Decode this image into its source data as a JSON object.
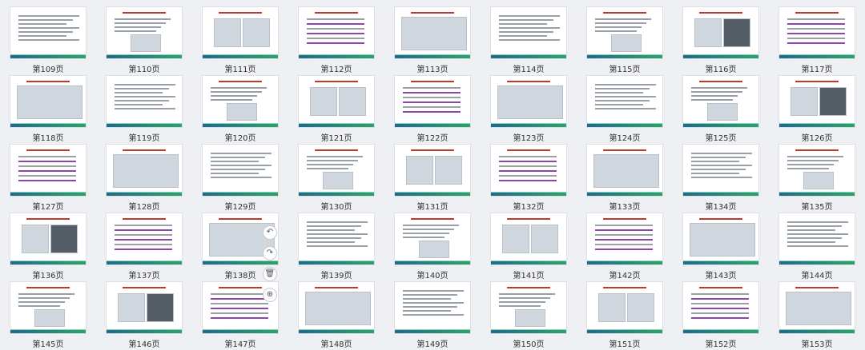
{
  "pages": [
    "第109页",
    "第110页",
    "第111页",
    "第112页",
    "第113页",
    "第114页",
    "第115页",
    "第116页",
    "第117页",
    "第118页",
    "第119页",
    "第120页",
    "第121页",
    "第122页",
    "第123页",
    "第124页",
    "第125页",
    "第126页",
    "第127页",
    "第128页",
    "第129页",
    "第130页",
    "第131页",
    "第132页",
    "第133页",
    "第134页",
    "第135页",
    "第136页",
    "第137页",
    "第138页",
    "第139页",
    "第140页",
    "第141页",
    "第142页",
    "第143页",
    "第144页",
    "第145页",
    "第146页",
    "第147页",
    "第148页",
    "第149页",
    "第150页",
    "第151页",
    "第152页",
    "第153页"
  ],
  "tools": {
    "undo_icon": "↶",
    "redo_icon": "↷",
    "delete_icon": "🗑",
    "add_icon": "⊕"
  }
}
